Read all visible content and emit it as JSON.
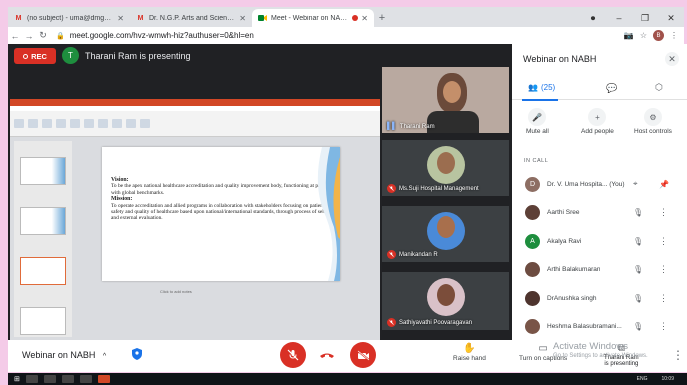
{
  "browser": {
    "tabs": [
      {
        "icon": "gmail-icon",
        "title": "(no subject) - uma@dmgpasc.a",
        "active": false
      },
      {
        "icon": "gmail-icon",
        "title": "Dr. N.G.P. Arts and Science Colle",
        "active": false
      },
      {
        "icon": "meet-icon",
        "title": "Meet - Webinar on NABH",
        "active": true
      }
    ],
    "url": "meet.google.com/hvz-wmwh-hiz?authuser=0&hl=en",
    "profile_initial": "B"
  },
  "meeting": {
    "rec_label": "REC",
    "presenter_initial": "T",
    "presenter_status": "Tharani Ram is presenting",
    "title": "Webinar on NABH"
  },
  "slide": {
    "vision_heading": "Vision:",
    "vision_text": "To be the apex national healthcare accreditation and quality improvement body, functioning at par with global benchmarks.",
    "mission_heading": "Mission:",
    "mission_text": "To operate accreditation and allied programs in collaboration with stakeholders focusing on patient safety and quality of healthcare based upon national/international standards, through process of self and external evaluation.",
    "notes_placeholder": "Click to add notes"
  },
  "tiles": [
    {
      "name": "Tharani Ram",
      "muted": false
    },
    {
      "name": "Ms.Suji Hospital Management",
      "muted": true
    },
    {
      "name": "Manikandan R",
      "muted": true
    },
    {
      "name": "Sathiyavathi Poovaragavan",
      "muted": true
    }
  ],
  "controls": {
    "raise_hand": "Raise hand",
    "turn_on_captions": "Turn on captions",
    "presenting_line1": "Tharani Ram",
    "presenting_line2": "is presenting"
  },
  "watermark": {
    "line1": "Activate Windows",
    "line2": "Go to Settings to activate Windows."
  },
  "panel": {
    "title": "Webinar on NABH",
    "people_count": "(25)",
    "actions": [
      {
        "icon": "mic-off-icon",
        "label": "Mute all"
      },
      {
        "icon": "add-person-icon",
        "label": "Add people"
      },
      {
        "icon": "host-controls-icon",
        "label": "Host controls"
      }
    ],
    "section_label": "IN CALL",
    "participants": [
      {
        "initial": "D",
        "name": "Dr. V. Uma Hospita... (You)",
        "color": "#8d6e63"
      },
      {
        "initial": "",
        "name": "Aarthi Sree",
        "color": "#5d4037"
      },
      {
        "initial": "A",
        "name": "Akalya Ravi",
        "color": "#1e8e3e"
      },
      {
        "initial": "",
        "name": "Arthi Balakumaran",
        "color": "#6d4c41"
      },
      {
        "initial": "",
        "name": "DrAnushka singh",
        "color": "#4e342e"
      },
      {
        "initial": "",
        "name": "Heshma Balasubramani...",
        "color": "#795548"
      }
    ]
  },
  "taskbar": {
    "time": "10:09",
    "lang": "ENG"
  },
  "colors": {
    "rec": "#d93025",
    "accent": "#1a73e8",
    "meet_bg": "#202124",
    "page_bg": "#f4cbe8"
  }
}
